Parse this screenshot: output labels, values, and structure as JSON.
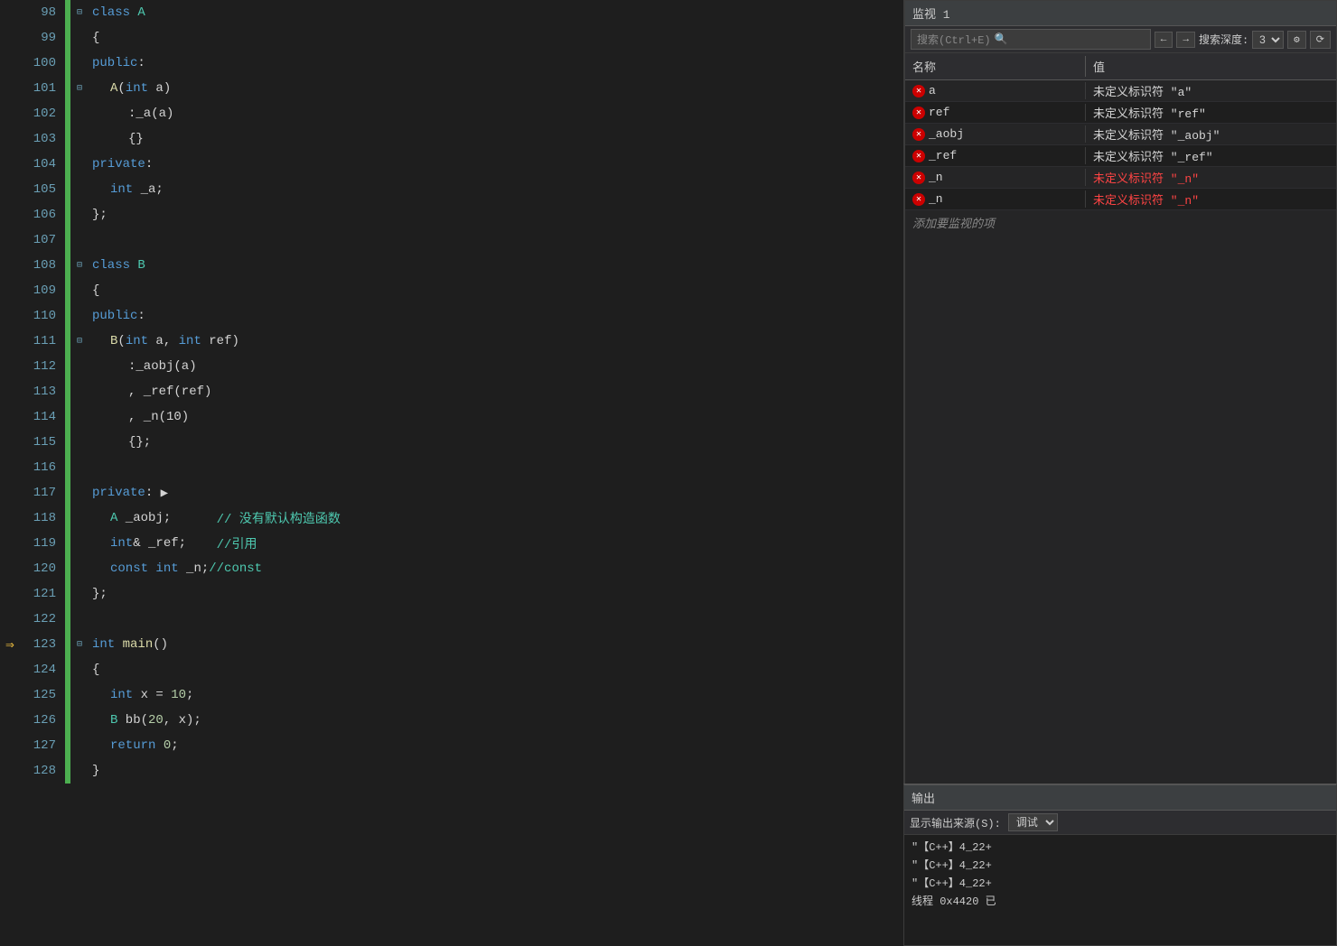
{
  "editor": {
    "lines": [
      {
        "num": 98,
        "fold": true,
        "indent": 0,
        "tokens": [
          {
            "t": "class ",
            "c": "kw"
          },
          {
            "t": "A",
            "c": "class-name"
          }
        ],
        "green": true
      },
      {
        "num": 99,
        "indent": 0,
        "tokens": [
          {
            "t": "{",
            "c": "normal"
          }
        ],
        "green": true
      },
      {
        "num": 100,
        "indent": 0,
        "tokens": [
          {
            "t": "public",
            "c": "kw"
          },
          {
            "t": ":",
            "c": "normal"
          }
        ],
        "green": true
      },
      {
        "num": 101,
        "fold": true,
        "indent": 1,
        "tokens": [
          {
            "t": "A",
            "c": "method"
          },
          {
            "t": "(",
            "c": "normal"
          },
          {
            "t": "int",
            "c": "kw"
          },
          {
            "t": " a)",
            "c": "normal"
          }
        ],
        "green": true
      },
      {
        "num": 102,
        "indent": 2,
        "tokens": [
          {
            "t": ":_a(a)",
            "c": "normal"
          }
        ],
        "green": true
      },
      {
        "num": 103,
        "indent": 2,
        "tokens": [
          {
            "t": "{}",
            "c": "normal"
          }
        ],
        "green": true
      },
      {
        "num": 104,
        "indent": 0,
        "tokens": [
          {
            "t": "private",
            "c": "kw"
          },
          {
            "t": ":",
            "c": "normal"
          }
        ],
        "green": true
      },
      {
        "num": 105,
        "indent": 1,
        "tokens": [
          {
            "t": "int",
            "c": "kw"
          },
          {
            "t": " _a;",
            "c": "normal"
          }
        ],
        "green": true
      },
      {
        "num": 106,
        "indent": 0,
        "tokens": [
          {
            "t": "};",
            "c": "normal"
          }
        ],
        "green": true
      },
      {
        "num": 107,
        "indent": 0,
        "tokens": [],
        "green": true
      },
      {
        "num": 108,
        "fold": true,
        "indent": 0,
        "tokens": [
          {
            "t": "class ",
            "c": "kw"
          },
          {
            "t": "B",
            "c": "class-name"
          }
        ],
        "green": true
      },
      {
        "num": 109,
        "indent": 0,
        "tokens": [
          {
            "t": "{",
            "c": "normal"
          }
        ],
        "green": true
      },
      {
        "num": 110,
        "indent": 0,
        "tokens": [
          {
            "t": "public",
            "c": "kw"
          },
          {
            "t": ":",
            "c": "normal"
          }
        ],
        "green": true
      },
      {
        "num": 111,
        "fold": true,
        "indent": 1,
        "tokens": [
          {
            "t": "B",
            "c": "method"
          },
          {
            "t": "(",
            "c": "normal"
          },
          {
            "t": "int",
            "c": "kw"
          },
          {
            "t": " a, ",
            "c": "normal"
          },
          {
            "t": "int",
            "c": "kw"
          },
          {
            "t": " ref)",
            "c": "normal"
          }
        ],
        "green": true
      },
      {
        "num": 112,
        "indent": 2,
        "tokens": [
          {
            "t": ":_aobj(a)",
            "c": "normal"
          }
        ],
        "green": true
      },
      {
        "num": 113,
        "indent": 2,
        "tokens": [
          {
            "t": ", _ref(ref)",
            "c": "normal"
          }
        ],
        "green": true
      },
      {
        "num": 114,
        "indent": 2,
        "tokens": [
          {
            "t": ", _n(10)",
            "c": "normal"
          }
        ],
        "green": true
      },
      {
        "num": 115,
        "indent": 2,
        "tokens": [
          {
            "t": "{};",
            "c": "normal"
          }
        ],
        "green": true
      },
      {
        "num": 116,
        "indent": 0,
        "tokens": [],
        "green": true
      },
      {
        "num": 117,
        "indent": 0,
        "tokens": [
          {
            "t": "private",
            "c": "kw"
          },
          {
            "t": ":",
            "c": "normal"
          },
          {
            "t": " ▶",
            "c": "normal"
          }
        ],
        "green": true
      },
      {
        "num": 118,
        "indent": 1,
        "tokens": [
          {
            "t": "A",
            "c": "class-name"
          },
          {
            "t": " _aobj;      ",
            "c": "normal"
          },
          {
            "t": "// 没有默认构造函数",
            "c": "comment"
          }
        ],
        "green": true
      },
      {
        "num": 119,
        "indent": 1,
        "tokens": [
          {
            "t": "int",
            "c": "kw"
          },
          {
            "t": "& _ref;    ",
            "c": "normal"
          },
          {
            "t": "//引用",
            "c": "comment"
          }
        ],
        "green": true
      },
      {
        "num": 120,
        "indent": 1,
        "tokens": [
          {
            "t": "const ",
            "c": "kw"
          },
          {
            "t": "int",
            "c": "kw"
          },
          {
            "t": " _n;",
            "c": "normal"
          },
          {
            "t": "//const",
            "c": "comment"
          }
        ],
        "green": true
      },
      {
        "num": 121,
        "indent": 0,
        "tokens": [
          {
            "t": "};",
            "c": "normal"
          }
        ],
        "green": true
      },
      {
        "num": 122,
        "indent": 0,
        "tokens": [],
        "green": true
      },
      {
        "num": 123,
        "fold": true,
        "indent": 0,
        "tokens": [
          {
            "t": "int",
            "c": "kw"
          },
          {
            "t": " ",
            "c": "normal"
          },
          {
            "t": "main",
            "c": "method"
          },
          {
            "t": "()",
            "c": "normal"
          }
        ],
        "green": true,
        "arrow": true
      },
      {
        "num": 124,
        "indent": 0,
        "tokens": [
          {
            "t": "{",
            "c": "normal"
          }
        ],
        "green": true
      },
      {
        "num": 125,
        "indent": 1,
        "tokens": [
          {
            "t": "int",
            "c": "kw"
          },
          {
            "t": " x = ",
            "c": "normal"
          },
          {
            "t": "10",
            "c": "number"
          },
          {
            "t": ";",
            "c": "normal"
          }
        ],
        "green": true
      },
      {
        "num": 126,
        "indent": 1,
        "tokens": [
          {
            "t": "B",
            "c": "class-name"
          },
          {
            "t": " bb(",
            "c": "normal"
          },
          {
            "t": "20",
            "c": "number"
          },
          {
            "t": ", x);",
            "c": "normal"
          }
        ],
        "green": true
      },
      {
        "num": 127,
        "indent": 1,
        "tokens": [
          {
            "t": "return ",
            "c": "kw"
          },
          {
            "t": "0",
            "c": "number"
          },
          {
            "t": ";",
            "c": "normal"
          }
        ],
        "green": true
      },
      {
        "num": 128,
        "indent": 0,
        "tokens": [
          {
            "t": "}",
            "c": "normal"
          }
        ],
        "green": true
      }
    ]
  },
  "watch_window": {
    "title": "监视 1",
    "search_placeholder": "搜索(Ctrl+E)",
    "search_depth_label": "搜索深度:",
    "depth_value": "3",
    "col_name": "名称",
    "col_value": "值",
    "items": [
      {
        "name": "a",
        "value": "未定义标识符 \"a\"",
        "error": true
      },
      {
        "name": "ref",
        "value": "未定义标识符 \"ref\"",
        "error": true
      },
      {
        "name": "_aobj",
        "value": "未定义标识符 \"_aobj\"",
        "error": true
      },
      {
        "name": "_ref",
        "value": "未定义标识符 \"_ref\"",
        "error": true
      },
      {
        "name": "_n",
        "value": "未定义标识符 \"_n\"",
        "error": true,
        "red_value": true
      },
      {
        "name": "_n",
        "value": "未定义标识符 \"_n\"",
        "error": true,
        "red_value": true
      }
    ],
    "add_watch_label": "添加要监视的项"
  },
  "output_panel": {
    "title": "输出",
    "source_label": "显示输出来源(S):",
    "lines": [
      "\"【C++】4_22+",
      "\"【C++】4_22+",
      "\"【C++】4_22+",
      "线程 0x4420 已"
    ]
  }
}
